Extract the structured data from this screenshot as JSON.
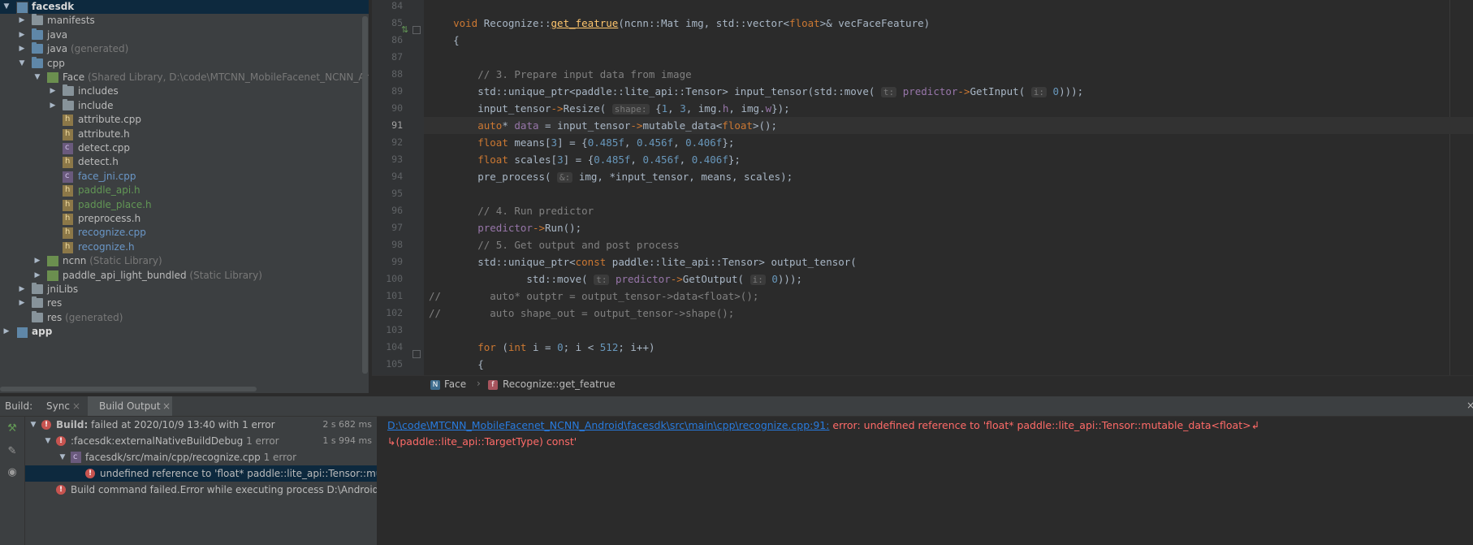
{
  "project_tree": {
    "items": [
      {
        "label": "facesdk",
        "suffix": "",
        "depth": 0,
        "arrow": "▼",
        "icon": "module",
        "style": "bold",
        "selected": true
      },
      {
        "label": "manifests",
        "suffix": "",
        "depth": 1,
        "arrow": "▶",
        "icon": "folder",
        "style": "",
        "selected": false
      },
      {
        "label": "java",
        "suffix": "",
        "depth": 1,
        "arrow": "▶",
        "icon": "folder-src",
        "style": "",
        "selected": false
      },
      {
        "label": "java",
        "suffix": "(generated)",
        "depth": 1,
        "arrow": "▶",
        "icon": "folder-gen",
        "style": "",
        "selected": false
      },
      {
        "label": "cpp",
        "suffix": "",
        "depth": 1,
        "arrow": "▼",
        "icon": "folder-src",
        "style": "",
        "selected": false
      },
      {
        "label": "Face",
        "suffix": "(Shared Library, D:\\code\\MTCNN_MobileFacenet_NCNN_Andr",
        "depth": 2,
        "arrow": "▼",
        "icon": "lib",
        "style": "",
        "selected": false
      },
      {
        "label": "includes",
        "suffix": "",
        "depth": 3,
        "arrow": "▶",
        "icon": "folder",
        "style": "",
        "selected": false
      },
      {
        "label": "include",
        "suffix": "",
        "depth": 3,
        "arrow": "▶",
        "icon": "folder",
        "style": "",
        "selected": false
      },
      {
        "label": "attribute.cpp",
        "suffix": "",
        "depth": 3,
        "arrow": "",
        "icon": "file-h",
        "style": "",
        "selected": false
      },
      {
        "label": "attribute.h",
        "suffix": "",
        "depth": 3,
        "arrow": "",
        "icon": "file-h",
        "style": "",
        "selected": false
      },
      {
        "label": "detect.cpp",
        "suffix": "",
        "depth": 3,
        "arrow": "",
        "icon": "file-c",
        "style": "",
        "selected": false
      },
      {
        "label": "detect.h",
        "suffix": "",
        "depth": 3,
        "arrow": "",
        "icon": "file-h",
        "style": "",
        "selected": false
      },
      {
        "label": "face_jni.cpp",
        "suffix": "",
        "depth": 3,
        "arrow": "",
        "icon": "file-c",
        "style": "blue",
        "selected": false
      },
      {
        "label": "paddle_api.h",
        "suffix": "",
        "depth": 3,
        "arrow": "",
        "icon": "file-h",
        "style": "green",
        "selected": false
      },
      {
        "label": "paddle_place.h",
        "suffix": "",
        "depth": 3,
        "arrow": "",
        "icon": "file-h",
        "style": "green",
        "selected": false
      },
      {
        "label": "preprocess.h",
        "suffix": "",
        "depth": 3,
        "arrow": "",
        "icon": "file-h",
        "style": "",
        "selected": false
      },
      {
        "label": "recognize.cpp",
        "suffix": "",
        "depth": 3,
        "arrow": "",
        "icon": "file-h",
        "style": "blue",
        "selected": false
      },
      {
        "label": "recognize.h",
        "suffix": "",
        "depth": 3,
        "arrow": "",
        "icon": "file-h",
        "style": "blue",
        "selected": false
      },
      {
        "label": "ncnn",
        "suffix": "(Static Library)",
        "depth": 2,
        "arrow": "▶",
        "icon": "lib",
        "style": "",
        "selected": false
      },
      {
        "label": "paddle_api_light_bundled",
        "suffix": "(Static Library)",
        "depth": 2,
        "arrow": "▶",
        "icon": "lib",
        "style": "",
        "selected": false
      },
      {
        "label": "jniLibs",
        "suffix": "",
        "depth": 1,
        "arrow": "▶",
        "icon": "folder",
        "style": "",
        "selected": false
      },
      {
        "label": "res",
        "suffix": "",
        "depth": 1,
        "arrow": "▶",
        "icon": "folder",
        "style": "",
        "selected": false
      },
      {
        "label": "res",
        "suffix": "(generated)",
        "depth": 1,
        "arrow": "",
        "icon": "folder",
        "style": "",
        "selected": false
      },
      {
        "label": "app",
        "suffix": "",
        "depth": 0,
        "arrow": "▶",
        "icon": "module",
        "style": "bold",
        "selected": false
      }
    ]
  },
  "editor": {
    "lines": [
      {
        "n": "84",
        "html": ""
      },
      {
        "n": "85",
        "html": "    <span class=\"kw\">void</span> Recognize::<span class=\"fn\">get_featrue</span>(ncnn::Mat img, std::vector&lt;<span class=\"kw\">float</span>&gt;&amp; vecFaceFeature)"
      },
      {
        "n": "86",
        "html": "    {"
      },
      {
        "n": "87",
        "html": ""
      },
      {
        "n": "88",
        "html": "        <span class=\"cm\">// 3. Prepare input data from image</span>"
      },
      {
        "n": "89",
        "html": "        std::unique_ptr&lt;paddle::lite_api::Tensor&gt; input_tensor(std::move( <span class=\"hint\">t:</span> <span class=\"mem\">predictor</span><span class=\"kw\">-&gt;</span>GetInput( <span class=\"hint\">i:</span> <span class=\"num\">0</span>)));"
      },
      {
        "n": "90",
        "html": "        input_tensor<span class=\"kw\">-&gt;</span>Resize( <span class=\"hint\">shape:</span> {<span class=\"num\">1</span>, <span class=\"num\">3</span>, img.<span class=\"mem\">h</span>, img.<span class=\"mem\">w</span>});"
      },
      {
        "n": "91",
        "html": "        <span class=\"kw\">auto</span>* <span class=\"mem\">data</span> = input_tensor<span class=\"kw\">-&gt;</span>mutable_data&lt;<span class=\"kw\">float</span>&gt;();",
        "current": true
      },
      {
        "n": "92",
        "html": "        <span class=\"kw\">float</span> means[<span class=\"num\">3</span>] = {<span class=\"num\">0.485f</span>, <span class=\"num\">0.456f</span>, <span class=\"num\">0.406f</span>};"
      },
      {
        "n": "93",
        "html": "        <span class=\"kw\">float</span> scales[<span class=\"num\">3</span>] = {<span class=\"num\">0.485f</span>, <span class=\"num\">0.456f</span>, <span class=\"num\">0.406f</span>};"
      },
      {
        "n": "94",
        "html": "        pre_process( <span class=\"hint\">&amp;:</span> img, *input_tensor, means, scales);"
      },
      {
        "n": "95",
        "html": ""
      },
      {
        "n": "96",
        "html": "        <span class=\"cm\">// 4. Run predictor</span>"
      },
      {
        "n": "97",
        "html": "        <span class=\"mem\">predictor</span><span class=\"kw\">-&gt;</span>Run();"
      },
      {
        "n": "98",
        "html": "        <span class=\"cm\">// 5. Get output and post process</span>"
      },
      {
        "n": "99",
        "html": "        std::unique_ptr&lt;<span class=\"kw\">const</span> paddle::lite_api::Tensor&gt; output_tensor("
      },
      {
        "n": "100",
        "html": "                std::move( <span class=\"hint\">t:</span> <span class=\"mem\">predictor</span><span class=\"kw\">-&gt;</span>GetOutput( <span class=\"hint\">i:</span> <span class=\"num\">0</span>)));"
      },
      {
        "n": "101",
        "html": "<span class=\"cm\">//        auto* outptr = output_tensor-&gt;data&lt;float&gt;();</span>"
      },
      {
        "n": "102",
        "html": "<span class=\"cm\">//        auto shape_out = output_tensor-&gt;shape();</span>"
      },
      {
        "n": "103",
        "html": ""
      },
      {
        "n": "104",
        "html": "        <span class=\"kw\">for</span> (<span class=\"kw\">int</span> i = <span class=\"num\">0</span>; i &lt; <span class=\"num\">512</span>; i++)"
      },
      {
        "n": "105",
        "html": "        {"
      }
    ]
  },
  "breadcrumb": {
    "items": [
      {
        "icon": "N",
        "label": "Face"
      },
      {
        "icon": "f",
        "label": "Recognize::get_featrue"
      }
    ]
  },
  "build": {
    "title": "Build:",
    "tab_sync": "Sync",
    "tab_output": "Build Output",
    "tab_close": "×",
    "corner": "×",
    "tree": [
      {
        "label_bold": "Build:",
        "label": " failed at 2020/10/9 13:40 with 1 error",
        "right": "2 s 682 ms",
        "depth": 0,
        "arrow": "▼",
        "selected": false,
        "icon": "error"
      },
      {
        "label_bold": "",
        "label": ":facesdk:externalNativeBuildDebug",
        "dim": "1 error",
        "right": "1 s 994 ms",
        "depth": 1,
        "arrow": "▼",
        "selected": false,
        "icon": "error"
      },
      {
        "label_bold": "",
        "label": "facesdk/src/main/cpp/recognize.cpp",
        "dim": "1 error",
        "right": "",
        "depth": 2,
        "arrow": "▼",
        "selected": false,
        "icon": "file"
      },
      {
        "label_bold": "",
        "label": "undefined reference to 'float* paddle::lite_api::Tensor::mutable",
        "right": "",
        "depth": 3,
        "arrow": "",
        "selected": true,
        "icon": "error"
      },
      {
        "label_bold": "",
        "label": "Build command failed.Error while executing process D:\\Android\\Sdk",
        "right": "",
        "depth": 1,
        "arrow": "",
        "selected": false,
        "icon": "error"
      }
    ],
    "output": {
      "link": "D:\\code\\MTCNN_MobileFacenet_NCNN_Android\\facesdk\\src\\main\\cpp\\recognize.cpp:91:",
      "error_1": " error: undefined reference to 'float* paddle::lite_api::Tensor::mutable_data<float>↲",
      "error_2": "↳(paddle::lite_api::TargetType) const'"
    }
  },
  "colors": {
    "background": "#2b2b2b",
    "panel": "#3c3f41",
    "selection": "#0d293e",
    "error": "#ff6b68",
    "link": "#287bde"
  }
}
